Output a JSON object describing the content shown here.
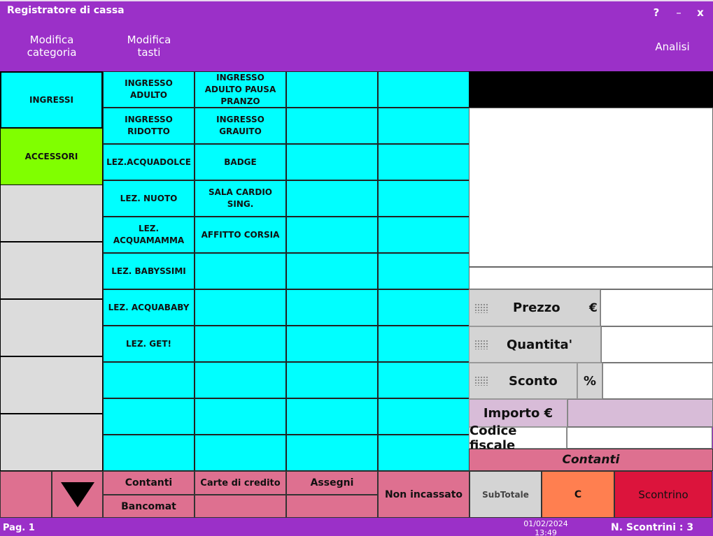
{
  "window": {
    "title": "Registratore di cassa",
    "help": "?",
    "minimize": "–",
    "close": "x"
  },
  "menu": {
    "edit_category": "Modifica\ncategoria",
    "edit_keys": "Modifica\ntasti",
    "analysis": "Analisi"
  },
  "categories": [
    "INGRESSI",
    "ACCESSORI",
    "",
    "",
    "",
    "",
    "",
    ""
  ],
  "products": [
    [
      "INGRESSO ADULTO",
      "INGRESSO ADULTO PAUSA PRANZO",
      "",
      ""
    ],
    [
      "INGRESSO RIDOTTO",
      "INGRESSO GRAUITO",
      "",
      ""
    ],
    [
      "LEZ.ACQUADOLCE",
      "BADGE",
      "",
      ""
    ],
    [
      "LEZ. NUOTO",
      "SALA CARDIO SING.",
      "",
      ""
    ],
    [
      "LEZ. ACQUAMAMMA",
      "AFFITTO CORSIA",
      "",
      ""
    ],
    [
      "LEZ. BABYSSIMI",
      "",
      "",
      ""
    ],
    [
      "LEZ. ACQUABABY",
      "",
      "",
      ""
    ],
    [
      "LEZ. GET!",
      "",
      "",
      ""
    ],
    [
      "",
      "",
      "",
      ""
    ],
    [
      "",
      "",
      "",
      ""
    ],
    [
      "",
      "",
      "",
      ""
    ]
  ],
  "fields": {
    "price_label": "Prezzo",
    "price_unit": "€",
    "price_value": "",
    "qty_label": "Quantita'",
    "qty_value": "",
    "discount_label": "Sconto",
    "discount_unit": "%",
    "discount_value": "",
    "amount_label": "Importo €",
    "amount_value": "",
    "fiscal_label": "Codice fiscale",
    "fiscal_value": ""
  },
  "payment_mode": "Contanti",
  "payments": {
    "cash": "Contanti",
    "card": "Carte di credito",
    "checks": "Assegni",
    "bancomat": "Bancomat",
    "not_collected": "Non incassato"
  },
  "actions": {
    "subtotal": "SubTotale",
    "clear": "C",
    "receipt": "Scontrino"
  },
  "status": {
    "page": "Pag. 1",
    "date": "01/02/2024",
    "time": "13:49",
    "receipts": "N. Scontrini : 3"
  },
  "colors": {
    "frame": "#9b30c8",
    "category_selected": "#00ffff",
    "category_accessori": "#80ff00",
    "category_empty": "#dcdcdc",
    "product": "#00ffff",
    "payment": "#de7090",
    "amount": "#d8bcd8",
    "clear": "#ff7f50",
    "receipt": "#dc143c"
  }
}
